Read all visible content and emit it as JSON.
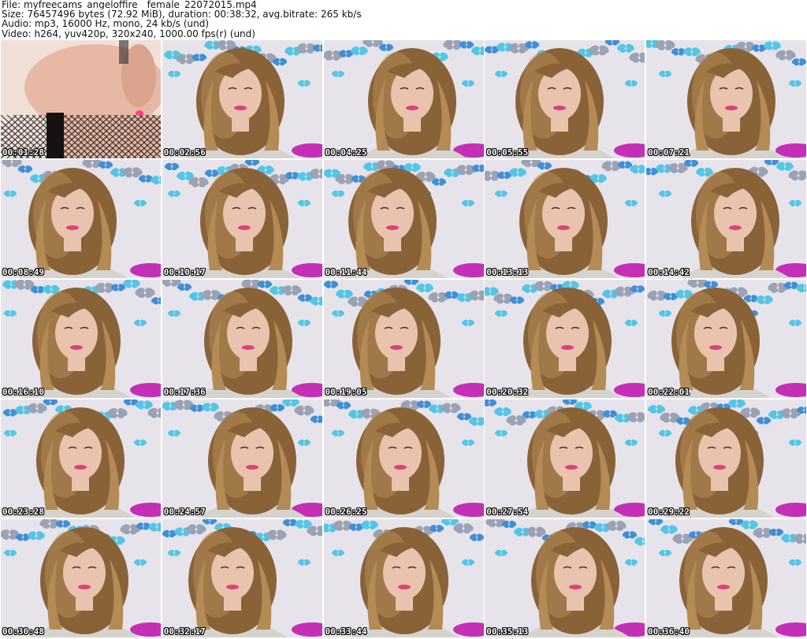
{
  "header": {
    "file": "File: myfreecams_angeloffire__female_22072015.mp4",
    "size": "Size: 76457496 bytes (72.92 MiB), duration: 00:38:32, avg.bitrate: 265 kb/s",
    "audio": "Audio: mp3, 16000 Hz, mono, 24 kb/s (und)",
    "video": "Video: h264, yuv420p, 320x240, 1000.00 fps(r) (und)"
  },
  "thumbnails": [
    {
      "time": "00:01:28",
      "scene": "closeup"
    },
    {
      "time": "00:02:56",
      "scene": "portrait"
    },
    {
      "time": "00:04:25",
      "scene": "portrait"
    },
    {
      "time": "00:05:55",
      "scene": "portrait"
    },
    {
      "time": "00:07:21",
      "scene": "portrait"
    },
    {
      "time": "00:08:49",
      "scene": "portrait"
    },
    {
      "time": "00:10:17",
      "scene": "portrait"
    },
    {
      "time": "00:11:44",
      "scene": "portrait"
    },
    {
      "time": "00:13:13",
      "scene": "portrait"
    },
    {
      "time": "00:14:42",
      "scene": "portrait"
    },
    {
      "time": "00:16:10",
      "scene": "portrait"
    },
    {
      "time": "00:17:36",
      "scene": "portrait"
    },
    {
      "time": "00:19:05",
      "scene": "portrait"
    },
    {
      "time": "00:20:32",
      "scene": "portrait"
    },
    {
      "time": "00:22:01",
      "scene": "portrait"
    },
    {
      "time": "00:23:28",
      "scene": "portrait"
    },
    {
      "time": "00:24:57",
      "scene": "portrait"
    },
    {
      "time": "00:26:25",
      "scene": "portrait"
    },
    {
      "time": "00:27:54",
      "scene": "portrait"
    },
    {
      "time": "00:29:22",
      "scene": "portrait"
    },
    {
      "time": "00:30:48",
      "scene": "portrait"
    },
    {
      "time": "00:32:17",
      "scene": "portrait"
    },
    {
      "time": "00:33:44",
      "scene": "portrait"
    },
    {
      "time": "00:35:13",
      "scene": "portrait"
    },
    {
      "time": "00:36:40",
      "scene": "portrait"
    }
  ],
  "colors": {
    "wall": "#e6e4ea",
    "butterfly_blue": "#3f8fd8",
    "butterfly_cyan": "#52c6e6",
    "butterfly_gray": "#9aa2b4",
    "hair": "#8a6238",
    "hair_light": "#b48a55",
    "skin": "#e9c3ae",
    "lips": "#e0407a",
    "pillow": "#c42fb6",
    "sweater": "#d6d3cf"
  }
}
